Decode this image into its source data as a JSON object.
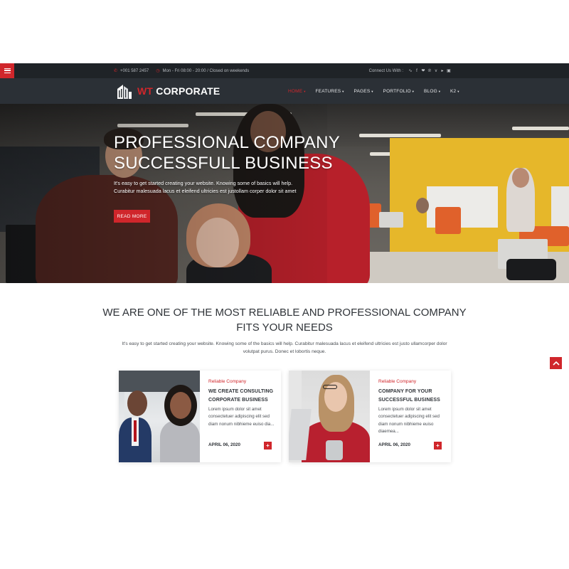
{
  "topbar": {
    "phone": "+001 587 2457",
    "hours": "Mon - Fri 08:00 - 20:00 / Closed on weekends",
    "connect_label": "Connect Us With :",
    "social_icons": [
      "rss-icon",
      "facebook-icon",
      "twitter-icon",
      "pinterest-icon",
      "vimeo-icon",
      "youtube-icon",
      "instagram-icon"
    ]
  },
  "header": {
    "logo_wt": "WT",
    "logo_corporate": "CORPORATE",
    "nav": [
      {
        "label": "HOME",
        "active": true
      },
      {
        "label": "FEATURES"
      },
      {
        "label": "PAGES"
      },
      {
        "label": "PORTFOLIO"
      },
      {
        "label": "BLOG"
      },
      {
        "label": "K2"
      }
    ]
  },
  "hero": {
    "title_line1": "PROFESSIONAL COMPANY",
    "title_line2": "SUCCESSFULL BUSINESS",
    "text": "It's easy to get started creating your website. Knowing some of basics will help. Curabitur malesuada lacus et eleifend ultricies est justollam corper dolor sit amet",
    "button": "READ MORE"
  },
  "about": {
    "title_line1": "WE ARE ONE OF THE MOST RELIABLE AND PROFESSIONAL COMPANY",
    "title_line2": "FITS YOUR NEEDS",
    "text": "It's easy to get started creating your website. Knowing some of the basics will help. Curabitur malesuada lacus et eleifend ultricies est justo ullamcorper dolor volutpat purus. Donec et lobortis neque."
  },
  "cards": [
    {
      "category": "Reliable Company",
      "title": "WE CREATE CONSULTING CORPORATE BUSINESS",
      "excerpt": "Lorem ipsum dolor sit amet consectetuer adipiscing elit sed diam nonum nibhieme euiso dia...",
      "date": "APRIL 06, 2020"
    },
    {
      "category": "Reliable Company",
      "title": "COMPANY FOR YOUR SUCCESSFUL BUSINESS",
      "excerpt": "Lorem ipsum dolor sit amet consectetuer adipiscing elit sed diam nonum nibhieme euiso diaemea...",
      "date": "APRIL 06, 2020"
    }
  ],
  "colors": {
    "accent": "#d0262b",
    "topbar": "#1f2327",
    "header": "#2b3036"
  }
}
